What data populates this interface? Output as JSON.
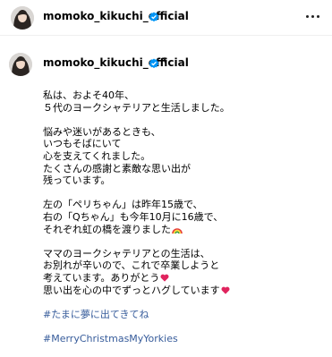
{
  "header": {
    "username": "momoko_kikuchi_official",
    "verified_icon": "verified-badge-icon",
    "more_icon": "more-options-icon",
    "verified_color": "#0095f6"
  },
  "caption": {
    "username": "momoko_kikuchi_official",
    "suffix": "*",
    "paragraphs": [
      "私は、およそ40年、\n５代のヨークシャテリアと生活しました。",
      "悩みや迷いがあるときも、\nいつもそばにいて\n心を支えてくれました。\nたくさんの感謝と素敵な思い出が\n残っています。",
      "左の「ペリちゃん」は昨年15歳で、\n右の「Qちゃん」も今年10月に16歳で、\nそれぞれ虹の橋を渡りました",
      "ママのヨークシャテリアとの生活は、\nお別れが辛いので、これで卒業しようと\n考えています。ありがとう",
      "思い出を心の中でずっとハグしています"
    ],
    "icons": {
      "rainbow": "rainbow-emoji-icon",
      "heart": "red-heart-emoji-icon"
    },
    "hashtags": [
      "#たまに夢に出てきてね",
      "#MerryChristmasMyYorkies"
    ],
    "link_color": "#375c9b",
    "heart_color": "#e0245e"
  }
}
